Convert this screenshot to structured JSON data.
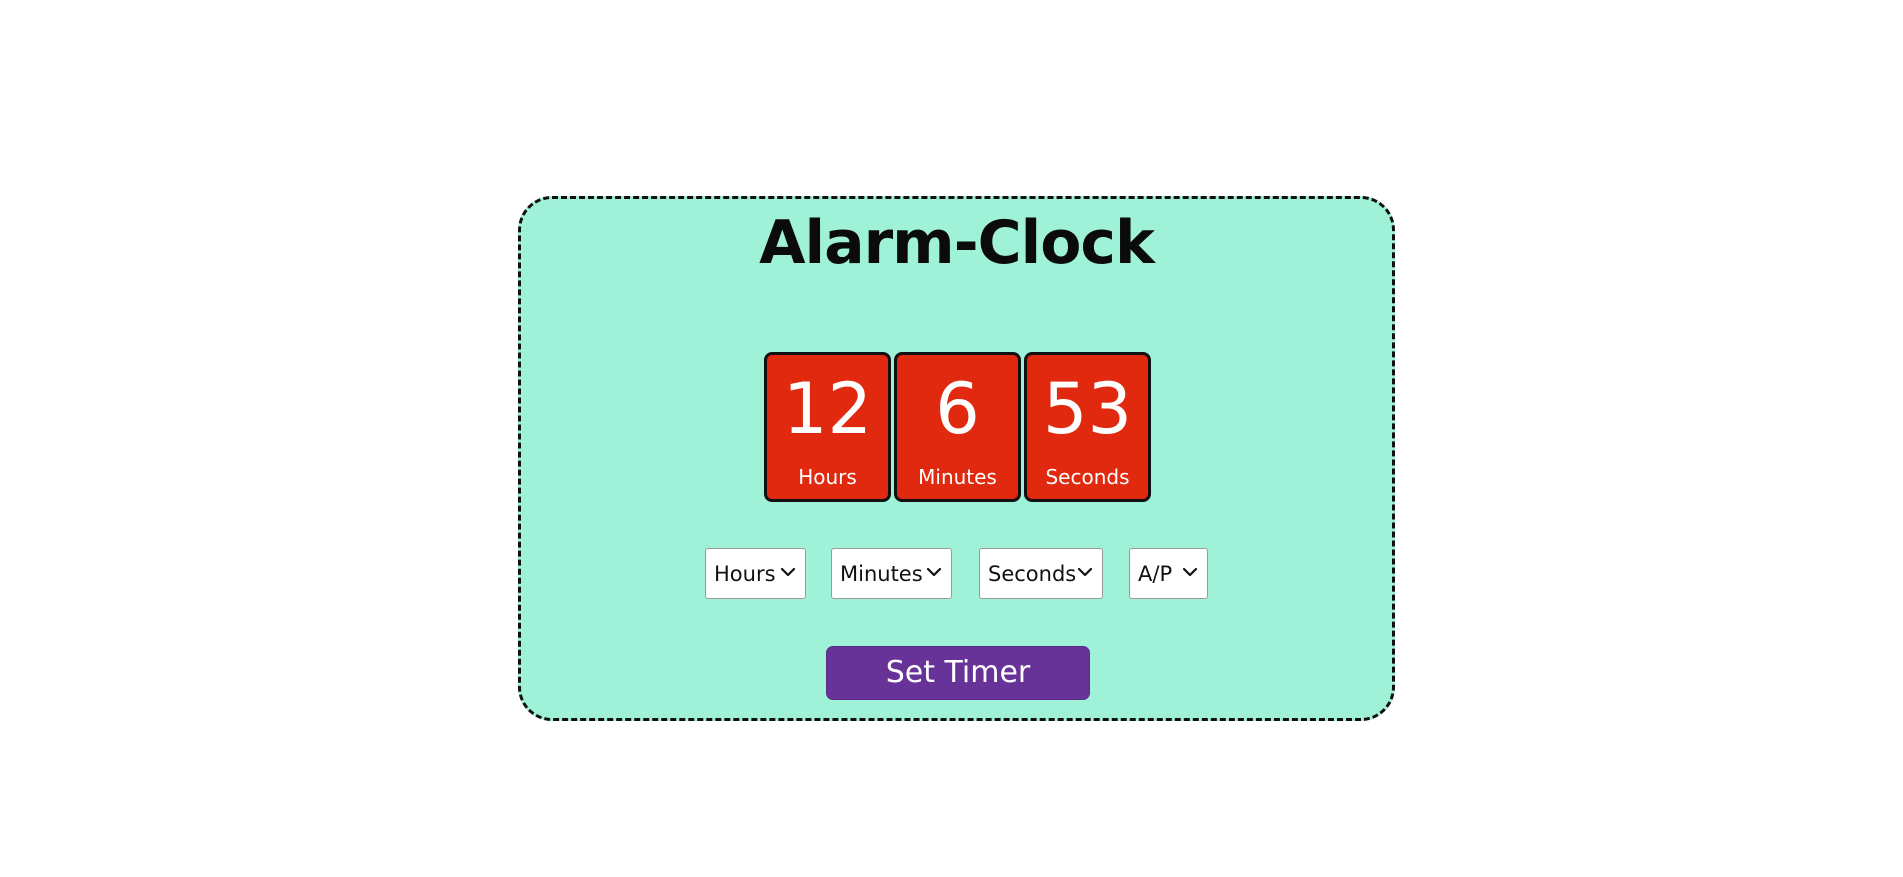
{
  "app": {
    "title": "Alarm-Clock"
  },
  "clock": {
    "hours": {
      "value": "12",
      "label": "Hours"
    },
    "minutes": {
      "value": "6",
      "label": "Minutes"
    },
    "seconds": {
      "value": "53",
      "label": "Seconds"
    }
  },
  "selects": {
    "hours": {
      "selected": "Hours",
      "icon": "chevron-down-icon"
    },
    "minutes": {
      "selected": "Minutes",
      "icon": "chevron-down-icon"
    },
    "seconds": {
      "selected": "Seconds",
      "icon": "chevron-down-icon"
    },
    "ampm": {
      "selected": "A/P",
      "icon": "chevron-down-icon"
    }
  },
  "actions": {
    "set_timer_label": "Set Timer"
  },
  "colors": {
    "card_background": "#9ff2d8",
    "tile_background": "#e0290e",
    "button_background": "#673399",
    "border": "#111111"
  }
}
